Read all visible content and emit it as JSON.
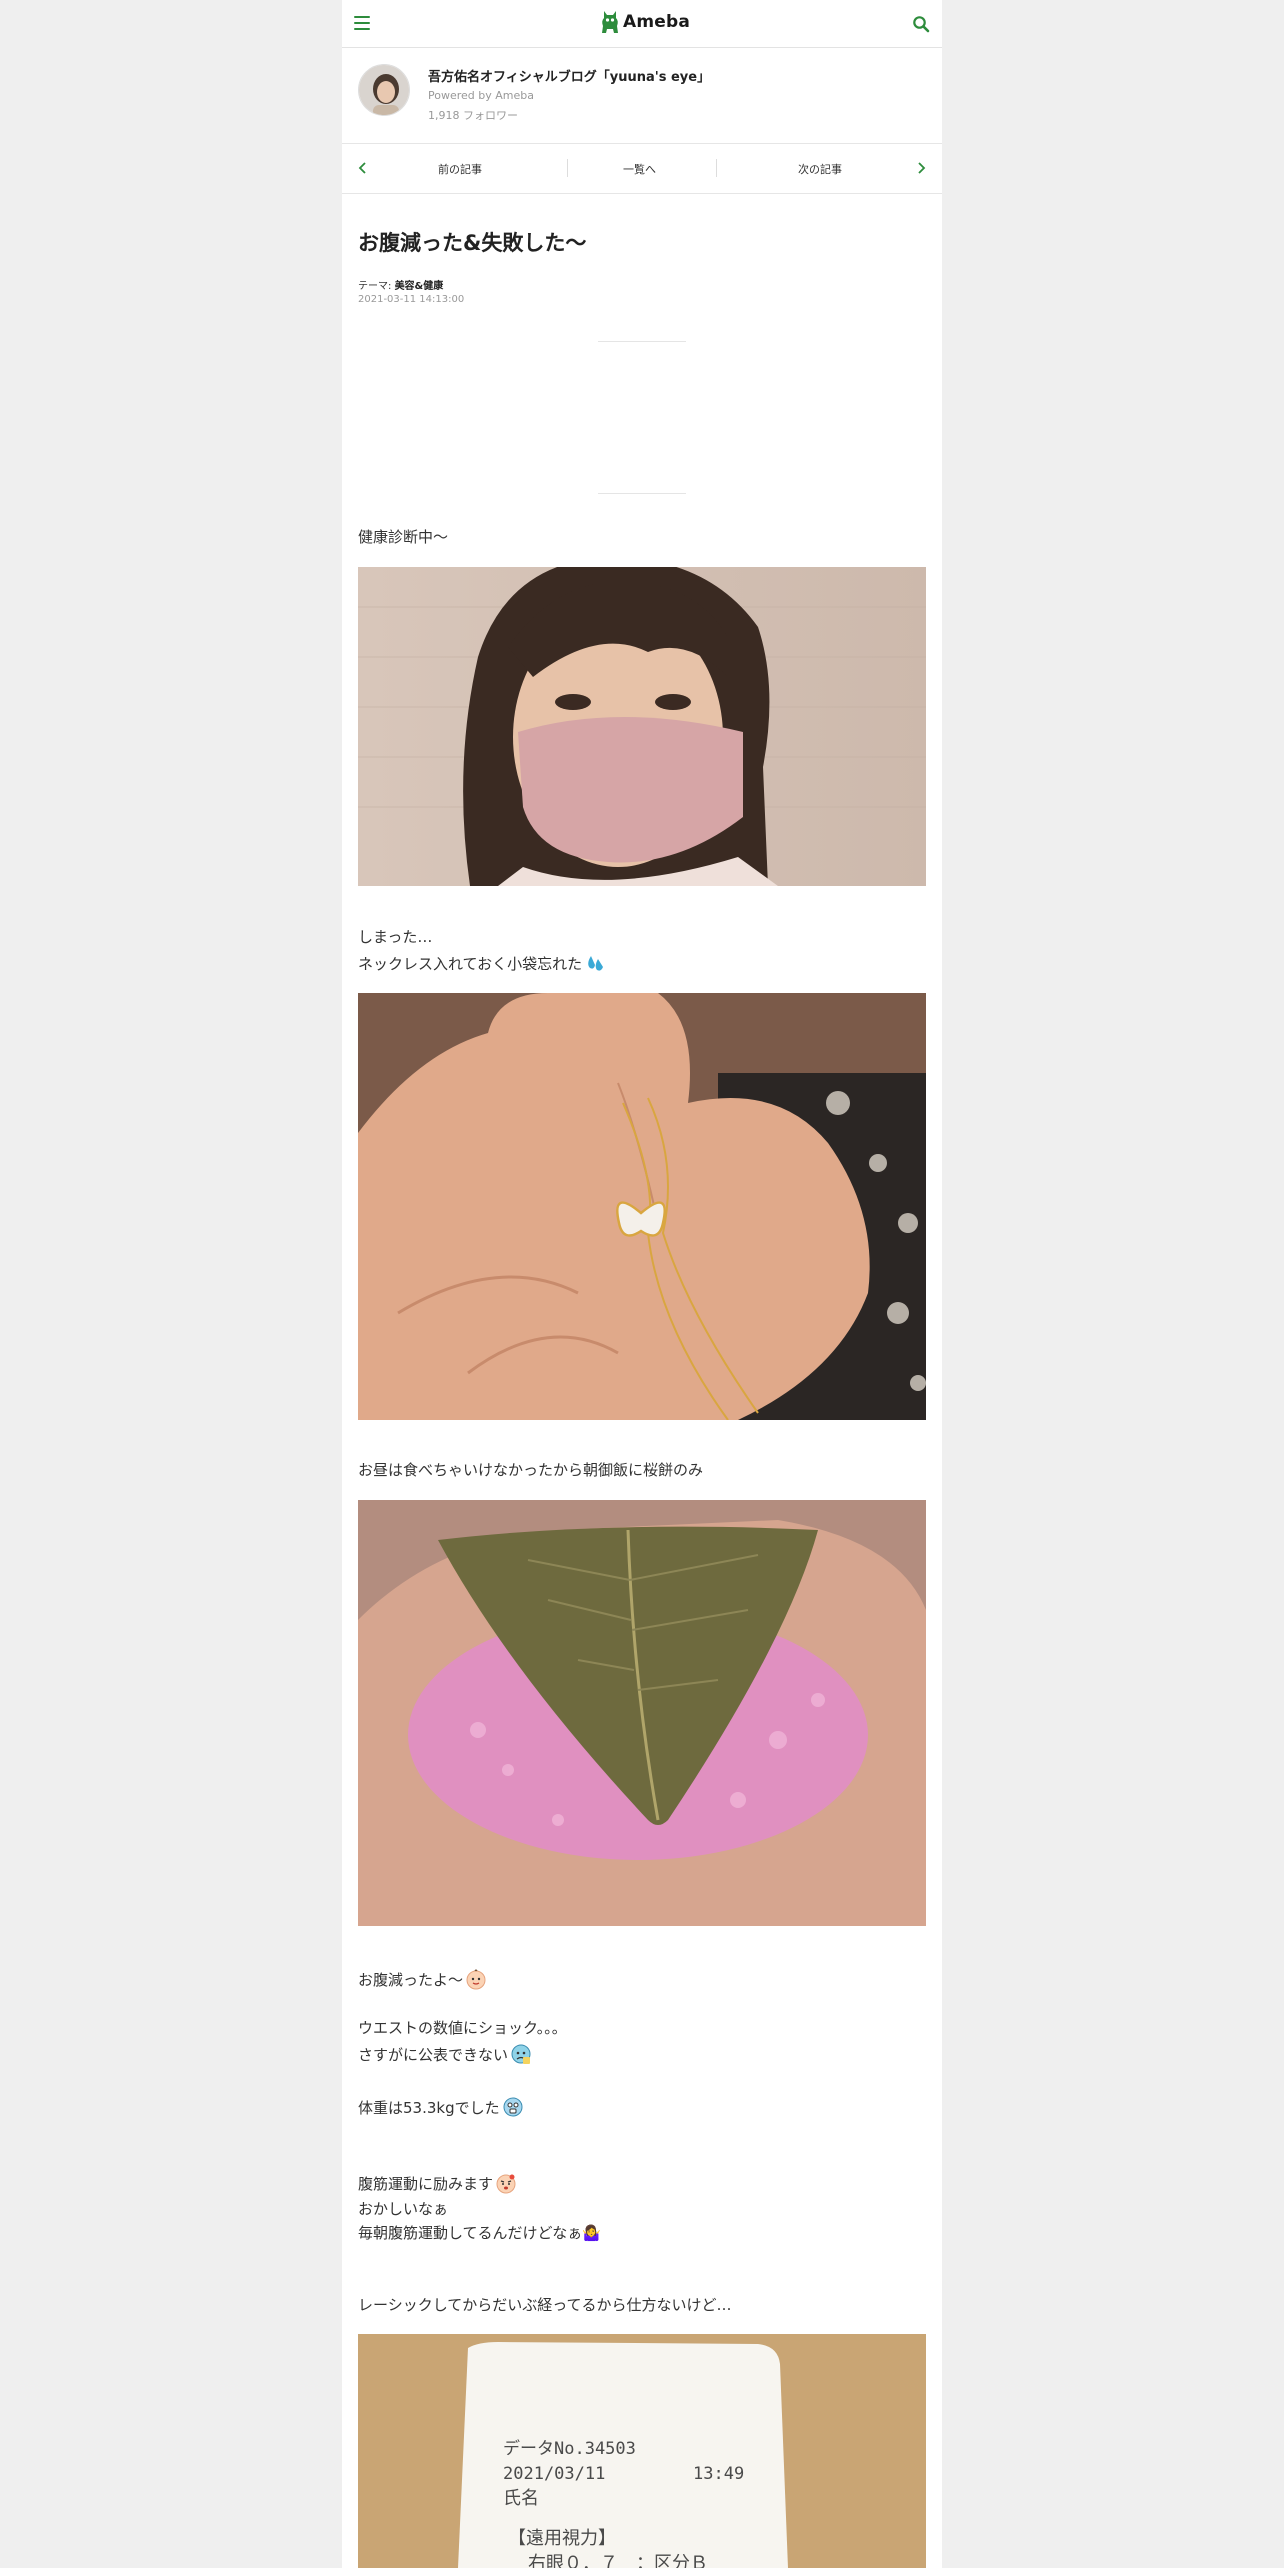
{
  "app": {
    "logo_text": "Ameba",
    "brand_color": "#2d8c3c"
  },
  "blog": {
    "title": "吾方佑名オフィシャルブログ「yuuna's eye」",
    "powered_by": "Powered by Ameba",
    "followers": "1,918 フォロワー"
  },
  "nav": {
    "prev_label": "前の記事",
    "list_label": "一覧へ",
    "next_label": "次の記事"
  },
  "article": {
    "title": "お腹減った&失敗した～",
    "theme_prefix": "テーマ:",
    "theme": "美容&健康",
    "date": "2021-03-11 14:13:00",
    "lines": {
      "l1": "健康診断中～",
      "l2": "しまった…",
      "l3": "ネックレス入れておく小袋忘れた",
      "l4": "お昼は食べちゃいけなかったから朝御飯に桜餅のみ",
      "l5": "お腹減ったよ～",
      "l6": "ウエストの数値にショック。。。",
      "l7": "さすがに公表できない",
      "l8": "体重は53.3kgでした",
      "l9": "腹筋運動に励みます",
      "l10": "おかしいなぁ",
      "l11": "毎朝腹筋運動してるんだけどなぁ🤷‍♀️",
      "l12": "レーシックしてからだいぶ経ってるから仕方ないけど…"
    },
    "receipt": {
      "data_no": "データNo.34503",
      "date": "2021/03/11",
      "time": "13:49",
      "name_label": "氏名",
      "section": "【遠用視力】",
      "right_eye": "右眼０．７　：区分Ｂ"
    }
  }
}
